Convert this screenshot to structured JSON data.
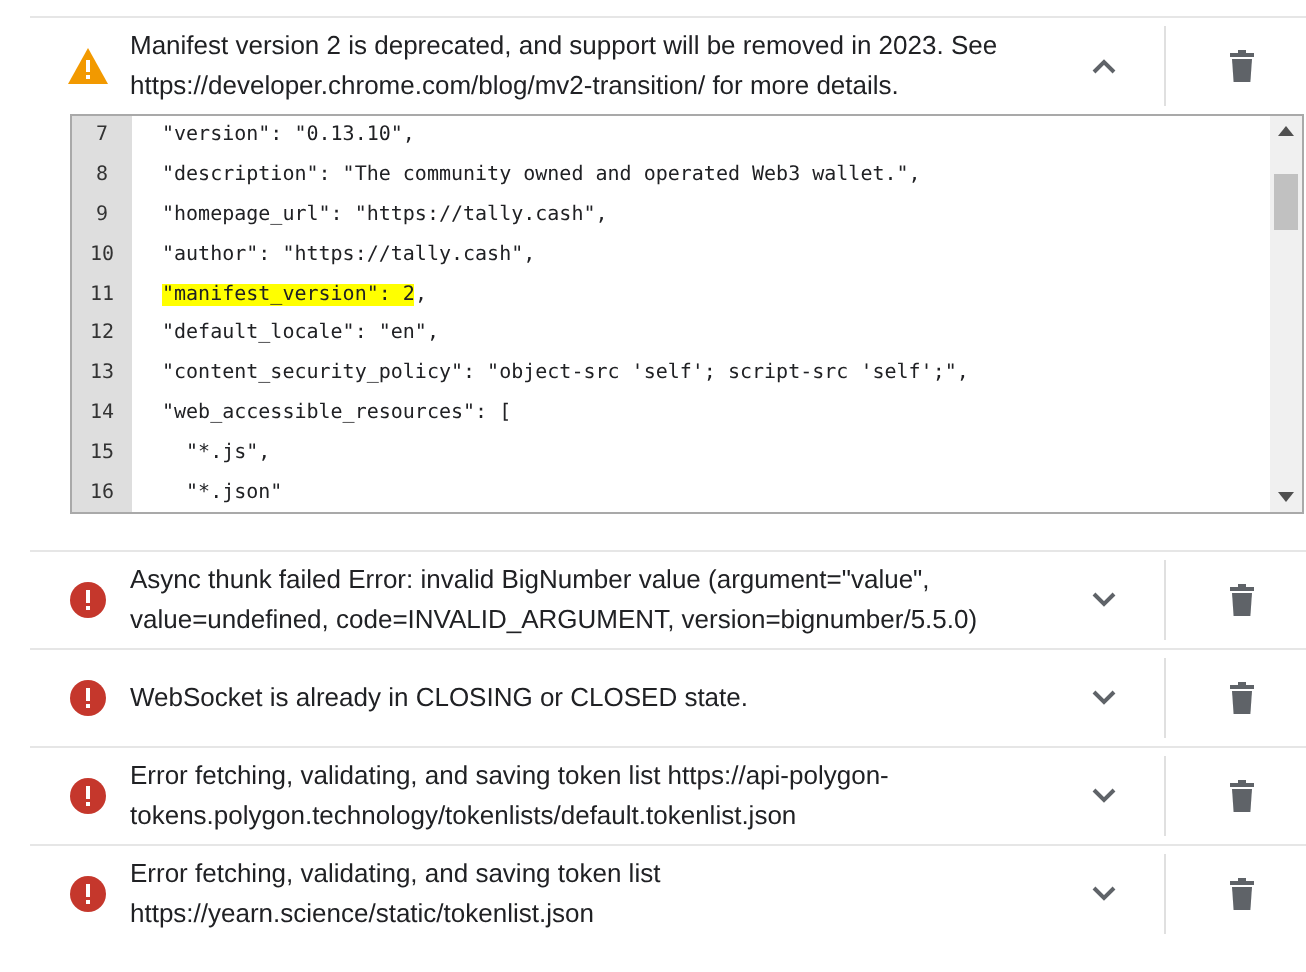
{
  "errors": [
    {
      "kind": "warning",
      "expanded": true,
      "message_lines": [
        "Manifest version 2 is deprecated, and support will be removed in 2023. See",
        "https://developer.chrome.com/blog/mv2-transition/ for more details."
      ],
      "code": [
        {
          "number": "7",
          "segments": [
            {
              "text": "\"version\": \"0.13.10\",",
              "highlighted": false
            }
          ]
        },
        {
          "number": "8",
          "segments": [
            {
              "text": "\"description\": \"The community owned and operated Web3 wallet.\",",
              "highlighted": false
            }
          ]
        },
        {
          "number": "9",
          "segments": [
            {
              "text": "\"homepage_url\": \"https://tally.cash\",",
              "highlighted": false
            }
          ]
        },
        {
          "number": "10",
          "segments": [
            {
              "text": "\"author\": \"https://tally.cash\",",
              "highlighted": false
            }
          ]
        },
        {
          "number": "11",
          "segments": [
            {
              "text": "\"manifest_version\": 2",
              "highlighted": true
            },
            {
              "text": ",",
              "highlighted": false
            }
          ]
        },
        {
          "number": "12",
          "segments": [
            {
              "text": "\"default_locale\": \"en\",",
              "highlighted": false
            }
          ]
        },
        {
          "number": "13",
          "segments": [
            {
              "text": "\"content_security_policy\": \"object-src 'self'; script-src 'self';\",",
              "highlighted": false
            }
          ]
        },
        {
          "number": "14",
          "segments": [
            {
              "text": "\"web_accessible_resources\": [",
              "highlighted": false
            }
          ]
        },
        {
          "number": "15",
          "segments": [
            {
              "text": "  \"*.js\",",
              "highlighted": false
            }
          ]
        },
        {
          "number": "16",
          "segments": [
            {
              "text": "  \"*.json\"",
              "highlighted": false
            }
          ]
        }
      ]
    },
    {
      "kind": "error",
      "expanded": false,
      "message_lines": [
        "Async thunk failed Error: invalid BigNumber value (argument=\"value\",",
        "value=undefined, code=INVALID_ARGUMENT, version=bignumber/5.5.0)"
      ]
    },
    {
      "kind": "error",
      "expanded": false,
      "message_lines": [
        "WebSocket is already in CLOSING or CLOSED state."
      ]
    },
    {
      "kind": "error",
      "expanded": false,
      "message_lines": [
        "Error fetching, validating, and saving token list https://api-polygon-",
        "tokens.polygon.technology/tokenlists/default.tokenlist.json"
      ]
    },
    {
      "kind": "error",
      "expanded": false,
      "message_lines": [
        "Error fetching, validating, and saving token list",
        "https://yearn.science/static/tokenlist.json"
      ]
    }
  ]
}
